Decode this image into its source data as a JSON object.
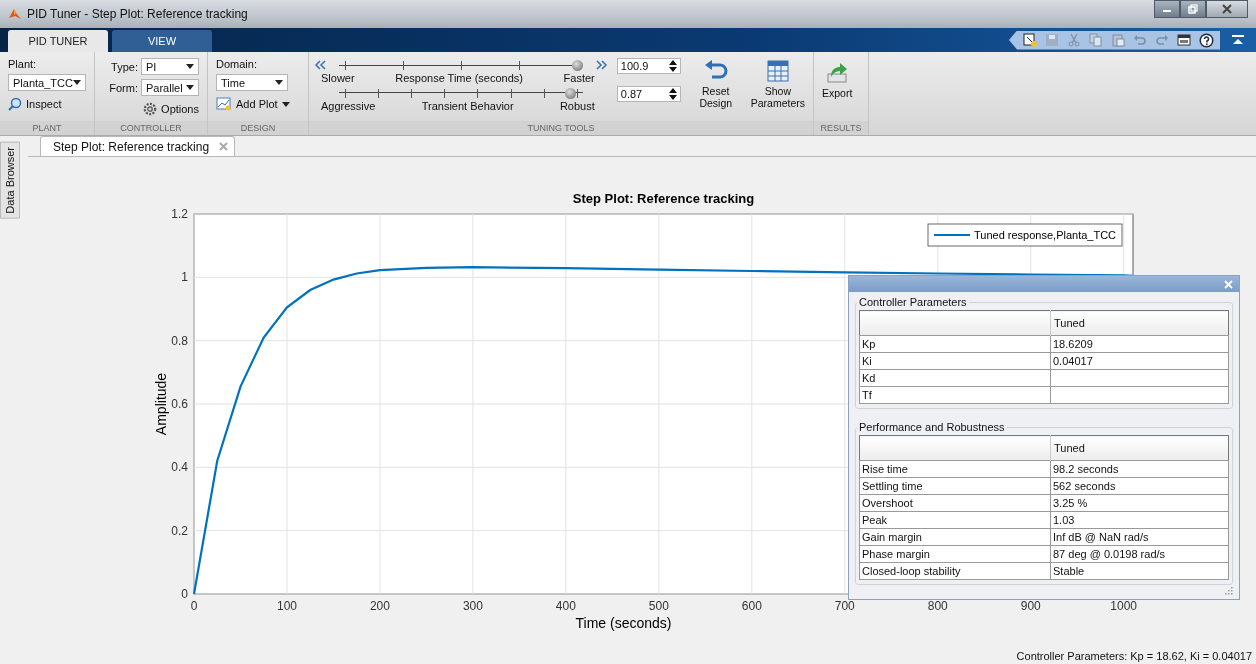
{
  "window": {
    "title": "PID Tuner - Step Plot: Reference tracking"
  },
  "ribbon_tabs": [
    {
      "label": "PID TUNER",
      "selected": true
    },
    {
      "label": "VIEW",
      "selected": false
    }
  ],
  "plant": {
    "label": "Plant:",
    "dropdown": "Planta_TCC",
    "inspect_button": "Inspect",
    "section": "PLANT"
  },
  "controller": {
    "type_label": "Type:",
    "type": "PI",
    "form_label": "Form:",
    "form": "Parallel",
    "options_button": "Options",
    "section": "CONTROLLER"
  },
  "design": {
    "domain_label": "Domain:",
    "domain": "Time",
    "add_plot_button": "Add Plot",
    "section": "DESIGN"
  },
  "tuning_tools": {
    "sliders": [
      {
        "left": "Slower",
        "caption": "Response Time (seconds)",
        "right": "Faster",
        "level": 1.0,
        "value": "100.9"
      },
      {
        "left": "Aggressive",
        "caption": "Transient Behavior",
        "right": "Robust",
        "level": 0.97,
        "value": "0.87"
      }
    ],
    "reset_button": "Reset Design",
    "show_parameters_button": "Show Parameters",
    "section": "TUNING TOOLS"
  },
  "results": {
    "export_button": "Export",
    "section": "RESULTS"
  },
  "side_tab": "Data Browser",
  "document_tabs": [
    {
      "label": "Step Plot: Reference tracking",
      "selected": true
    }
  ],
  "plot": {
    "chart_data": {
      "type": "line",
      "title": "Step Plot: Reference tracking",
      "xlabel": "Time (seconds)",
      "ylabel": "Amplitude",
      "x": [
        0,
        25,
        50,
        75,
        100,
        125,
        150,
        175,
        200,
        250,
        300,
        400,
        500,
        600,
        700,
        800,
        900,
        1000,
        1010
      ],
      "series": [
        {
          "name": "Tuned response,Planta_TCC",
          "color": "#0072bd",
          "values": [
            0,
            0.42,
            0.655,
            0.81,
            0.905,
            0.96,
            0.993,
            1.012,
            1.023,
            1.03,
            1.032,
            1.029,
            1.024,
            1.02,
            1.016,
            1.012,
            1.009,
            1.006,
            1.005
          ]
        }
      ],
      "xlim": [
        0,
        1010
      ],
      "ylim": [
        0,
        1.2
      ],
      "xticks": [
        0,
        100,
        200,
        300,
        400,
        500,
        600,
        700,
        800,
        900,
        1000
      ],
      "yticks": [
        0,
        0.2,
        0.4,
        0.6,
        0.8,
        1,
        1.2
      ],
      "grid": true
    }
  },
  "parameters_panel": {
    "controller_parameters": {
      "title": "Controller Parameters",
      "column": "Tuned",
      "rows": [
        {
          "name": "Kp",
          "value": "18.6209"
        },
        {
          "name": "Ki",
          "value": "0.04017"
        },
        {
          "name": "Kd"
        },
        {
          "name": "Tf"
        }
      ]
    },
    "performance": {
      "title": "Performance and Robustness",
      "column": "Tuned",
      "rows": [
        {
          "name": "Rise time",
          "value": "98.2 seconds"
        },
        {
          "name": "Settling time",
          "value": "562 seconds"
        },
        {
          "name": "Overshoot",
          "value": "3.25 %"
        },
        {
          "name": "Peak",
          "value": "1.03"
        },
        {
          "name": "Gain margin",
          "value": "Inf dB @ NaN rad/s"
        },
        {
          "name": "Phase margin",
          "value": "87 deg @ 0.0198 rad/s"
        },
        {
          "name": "Closed-loop stability",
          "value": "Stable"
        }
      ]
    }
  },
  "status_bar": "Controller Parameters: Kp = 18.62, Ki = 0.04017"
}
